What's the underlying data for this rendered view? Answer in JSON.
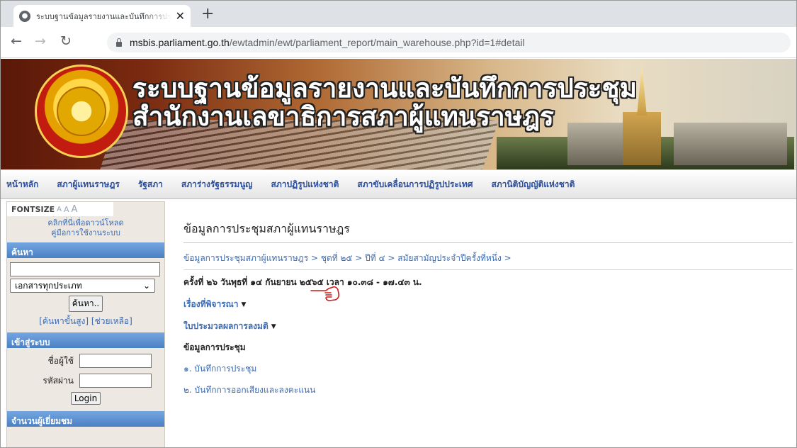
{
  "browser": {
    "tab_title": "ระบบฐานข้อมูลรายงานและบันทึกการประชุม",
    "url_host": "msbis.parliament.go.th",
    "url_path": "/ewtadmin/ewt/parliament_report/main_warehouse.php?id=1#detail"
  },
  "banner": {
    "title_line1": "ระบบฐานข้อมูลรายงานและบันทึกการประชุม",
    "title_line2": "สำนักงานเลขาธิการสภาผู้แทนราษฎร"
  },
  "menu": {
    "items": [
      {
        "label": "หน้าหลัก"
      },
      {
        "label": "สภาผู้แทนราษฎร"
      },
      {
        "label": "รัฐสภา"
      },
      {
        "label": "สภาร่างรัฐธรรมนูญ"
      },
      {
        "label": "สภาปฏิรูปแห่งชาติ"
      },
      {
        "label": "สภาขับเคลื่อนการปฏิรูปประเทศ"
      },
      {
        "label": "สภานิติบัญญัติแห่งชาติ"
      }
    ]
  },
  "sidebar": {
    "fontsize_label": "FONTSIZE",
    "fontsize_options": [
      "A",
      "A",
      "A"
    ],
    "download_line1": "คลิกที่นี่เพื่อดาวน์โหลด",
    "download_line2": "คู่มือการใช้งานระบบ",
    "search_heading": "ค้นหา",
    "search_value": "",
    "doc_type_selected": "เอกสารทุกประเภท",
    "search_button": "ค้นหา..",
    "advanced_link": "[ค้นหาขั้นสูง]",
    "help_link": "[ช่วยเหลือ]",
    "login_heading": "เข้าสู่ระบบ",
    "username_label": "ชื่อผู้ใช้",
    "password_label": "รหัสผ่าน",
    "login_button": "Login",
    "visitors_heading": "จำนวนผู้เยี่ยมชม"
  },
  "main": {
    "page_title": "ข้อมูลการประชุมสภาผู้แทนราษฎร",
    "breadcrumb": "ข้อมูลการประชุมสภาผู้แทนราษฎร > ชุดที่ ๒๕ > ปีที่ ๔ > สมัยสามัญประจำปีครั้งที่หนึ่ง >",
    "session_info": "ครั้งที่ ๒๖ วันพุธที่ ๑๔ กันยายน ๒๕๖๕ เวลา ๑๐.๓๘ - ๑๗.๔๓ น.",
    "toggle_agenda": "เรื่องที่พิจารณา",
    "toggle_votes": "ใบประมวลผลการลงมติ",
    "section_heading": "ข้อมูลการประชุม",
    "doc_links": [
      {
        "label": "๑. บันทึกการประชุม"
      },
      {
        "label": "๒. บันทึกการออกเสียงและลงคะแนน"
      }
    ]
  },
  "colors": {
    "link": "#3b6bb3",
    "menu_text": "#2a4ea0",
    "side_heading": "#4a7fc4",
    "pointer": "#d01818"
  }
}
